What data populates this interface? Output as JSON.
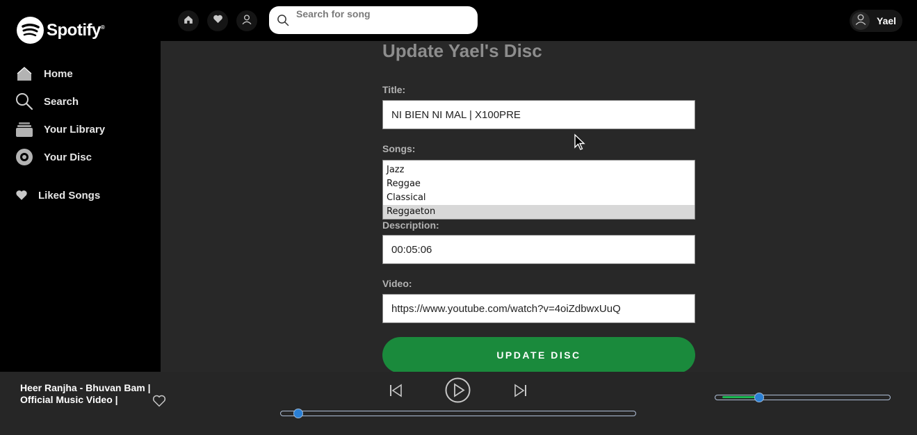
{
  "app": {
    "name": "Spotify"
  },
  "sidebar": {
    "items": [
      {
        "label": "Home",
        "icon": "home-icon"
      },
      {
        "label": "Search",
        "icon": "search-icon"
      },
      {
        "label": "Your Library",
        "icon": "library-icon"
      },
      {
        "label": "Your Disc",
        "icon": "disc-icon"
      },
      {
        "label": "Liked Songs",
        "icon": "heart-icon"
      }
    ]
  },
  "topbar": {
    "search_placeholder": "Search for song",
    "username": "Yael"
  },
  "form": {
    "heading": "Update Yael's Disc",
    "title_label": "Title:",
    "title_value": "NI BIEN NI MAL | X100PRE",
    "songs_label": "Songs:",
    "songs_options": [
      "Jazz",
      "Reggae",
      "Classical",
      "Reggaeton"
    ],
    "songs_selected": "Reggaeton",
    "description_label": "Description:",
    "description_value": "00:05:06",
    "video_label": "Video:",
    "video_value": "https://www.youtube.com/watch?v=4oiZdbwxUuQ",
    "submit_label": "UPDATE DISC"
  },
  "player": {
    "track_title": "Heer Ranjha - Bhuvan Bam | Official Music Video |",
    "progress": 0.04,
    "volume": 0.25,
    "colors": {
      "accent": "#1db954",
      "button": "#1a8a3c",
      "knob": "#2a7fd4"
    }
  }
}
